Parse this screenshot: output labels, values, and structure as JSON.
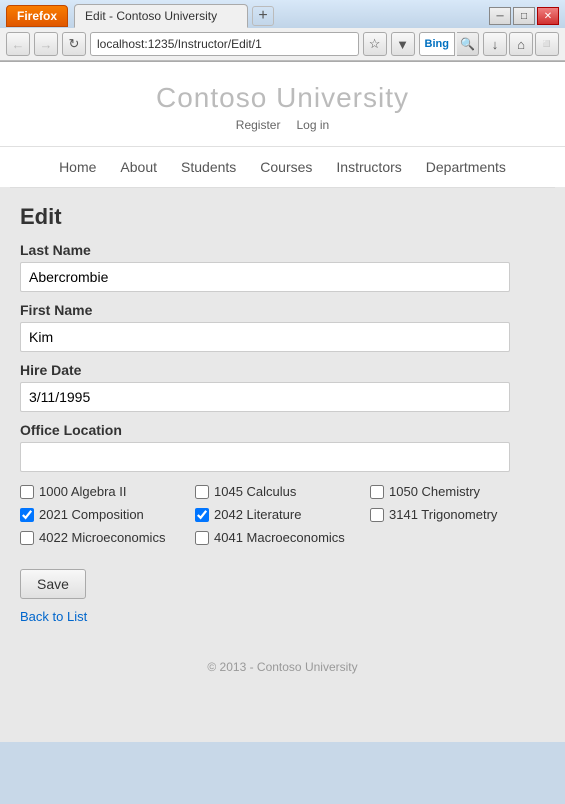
{
  "browser": {
    "firefox_label": "Firefox",
    "tab_title": "Edit - Contoso University",
    "tab_new": "+",
    "address": "localhost:1235/Instructor/Edit/1",
    "search_placeholder": "Bing",
    "win_minimize": "─",
    "win_restore": "□",
    "win_close": "✕"
  },
  "site": {
    "title": "Contoso University",
    "auth_register": "Register",
    "auth_login": "Log in",
    "nav": [
      "Home",
      "About",
      "Students",
      "Courses",
      "Instructors",
      "Departments"
    ]
  },
  "page": {
    "heading": "Edit",
    "last_name_label": "Last Name",
    "last_name_value": "Abercrombie",
    "first_name_label": "First Name",
    "first_name_value": "Kim",
    "hire_date_label": "Hire Date",
    "hire_date_value": "3/11/1995",
    "office_label": "Office Location",
    "office_value": "",
    "courses": [
      {
        "id": "1000",
        "name": "Algebra II",
        "checked": false
      },
      {
        "id": "1045",
        "name": "Calculus",
        "checked": false
      },
      {
        "id": "1050",
        "name": "Chemistry",
        "checked": false
      },
      {
        "id": "2021",
        "name": "Composition",
        "checked": true
      },
      {
        "id": "2042",
        "name": "Literature",
        "checked": true
      },
      {
        "id": "3141",
        "name": "Trigonometry",
        "checked": false
      },
      {
        "id": "4022",
        "name": "Microeconomics",
        "checked": false
      },
      {
        "id": "4041",
        "name": "Macroeconomics",
        "checked": false
      }
    ],
    "save_button": "Save",
    "back_link": "Back to List"
  },
  "footer": {
    "text": "© 2013 - Contoso University"
  }
}
